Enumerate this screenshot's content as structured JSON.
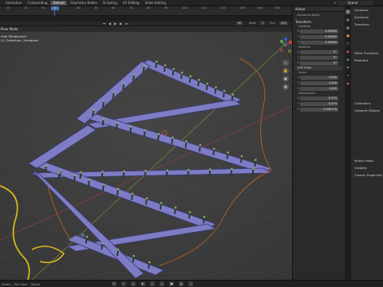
{
  "workspace_tabs": [
    "Animation",
    "Compositing",
    "Default",
    "Geometry Nodes",
    "Scripting",
    "UV Editing",
    "Video Editing"
  ],
  "active_tab": "Default",
  "scene": {
    "label": "Scene"
  },
  "timeline": {
    "ticks": [
      "10",
      "20",
      "30",
      "40",
      "50",
      "60",
      "70",
      "80",
      "90",
      "100",
      "110",
      "120",
      "130",
      "140",
      "150",
      "160"
    ],
    "current_frame": "1",
    "start_label": "Start",
    "start_value": "1",
    "end_label": "End",
    "end_value": "250",
    "current_value": "90"
  },
  "viewport": {
    "mode_label": "Pose Mode",
    "info_lines": [
      "User Perspective",
      "(1) Collection | Armature"
    ]
  },
  "npanel": {
    "header": "Active",
    "sub": "Armature.Bone",
    "transform_title": "Transform",
    "location_label": "Location",
    "location": [
      {
        "axis": "X",
        "value": "0.00000"
      },
      {
        "axis": "Y",
        "value": "0.00000"
      },
      {
        "axis": "Z",
        "value": "0.00000"
      }
    ],
    "rotation_label": "Rotation",
    "rotation": [
      {
        "axis": "X",
        "value": "0°"
      },
      {
        "axis": "Y",
        "value": "0°"
      },
      {
        "axis": "Z",
        "value": "0°"
      }
    ],
    "rotation_mode": "XYZ Euler",
    "scale_label": "Scale",
    "scale": [
      {
        "axis": "X",
        "value": "1.000"
      },
      {
        "axis": "Y",
        "value": "1.000"
      },
      {
        "axis": "Z",
        "value": "1.000"
      }
    ],
    "dimensions_label": "Dimensions",
    "dimensions": [
      {
        "axis": "X",
        "value": "0.374"
      },
      {
        "axis": "Y",
        "value": "0.374"
      },
      {
        "axis": "Z",
        "value": "0.000178"
      }
    ]
  },
  "properties": {
    "items": [
      "Armature",
      "Armature",
      "Transform",
      "",
      "",
      "",
      "Delta Transform",
      "Relations",
      "",
      "",
      "",
      "",
      "",
      "Collections",
      "Viewport Display",
      "",
      "",
      "",
      "",
      "",
      "",
      "Motion Paths",
      "Visibility",
      "Custom Properties"
    ]
  },
  "statusbar": {
    "left": [
      "Select",
      "Pan View",
      "Object"
    ]
  },
  "colors": {
    "bone_fill": "#7d7cc4",
    "bone_edge": "#3c3a7a",
    "peg": "#2b3b2b",
    "peg_tip": "#8faf6a",
    "rope": "#d9b41c",
    "accent": "#4772b3"
  }
}
